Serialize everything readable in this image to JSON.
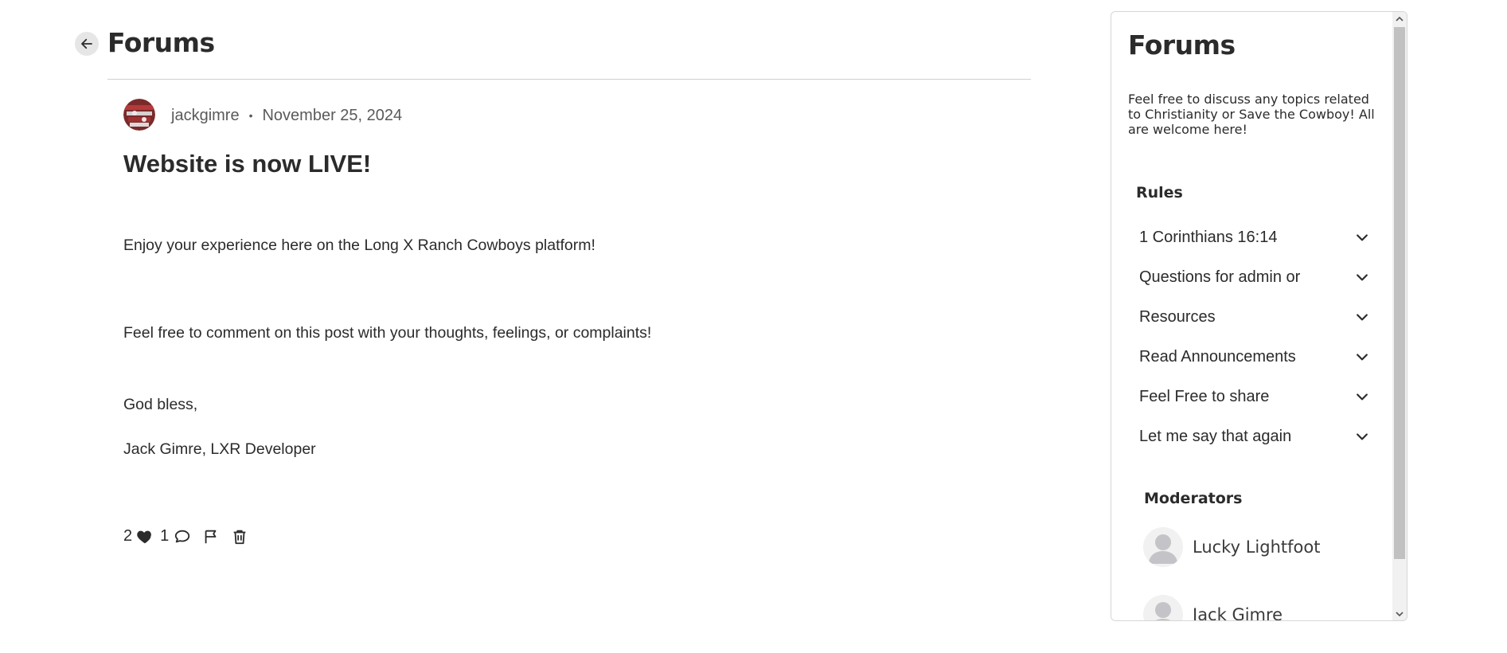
{
  "header": {
    "title": "Forums",
    "back_icon": "arrow-left-icon"
  },
  "post": {
    "author": "jackgimre",
    "date": "November 25, 2024",
    "title": "Website is now LIVE!",
    "paragraphs": [
      "Enjoy your experience here on the Long X Ranch Cowboys platform!",
      "Feel free to comment on this post with your thoughts, feelings, or complaints!",
      "God bless,",
      "Jack Gimre, LXR Developer"
    ],
    "likes": "2",
    "comments": "1",
    "icons": [
      "heart-icon",
      "comment-icon",
      "flag-icon",
      "trash-icon"
    ]
  },
  "sidebar": {
    "title": "Forums",
    "description": "Feel free to discuss any topics related to Christianity or Save the Cowboy! All are welcome here!",
    "rules_heading": "Rules",
    "rules": [
      {
        "label": "1 Corinthians 16:14"
      },
      {
        "label": "Questions for admin or"
      },
      {
        "label": "Resources"
      },
      {
        "label": "Read Announcements"
      },
      {
        "label": "Feel Free to share"
      },
      {
        "label": "Let me say that again"
      }
    ],
    "moderators_heading": "Moderators",
    "moderators": [
      {
        "name": "Lucky Lightfoot"
      },
      {
        "name": "Jack Gimre"
      }
    ]
  },
  "colors": {
    "text": "#2b2b2b",
    "muted": "#5a5a5a",
    "divider": "#cfcfcf",
    "scrollbar_track": "#f1f1f1",
    "scrollbar_thumb": "#c1c1c1"
  }
}
